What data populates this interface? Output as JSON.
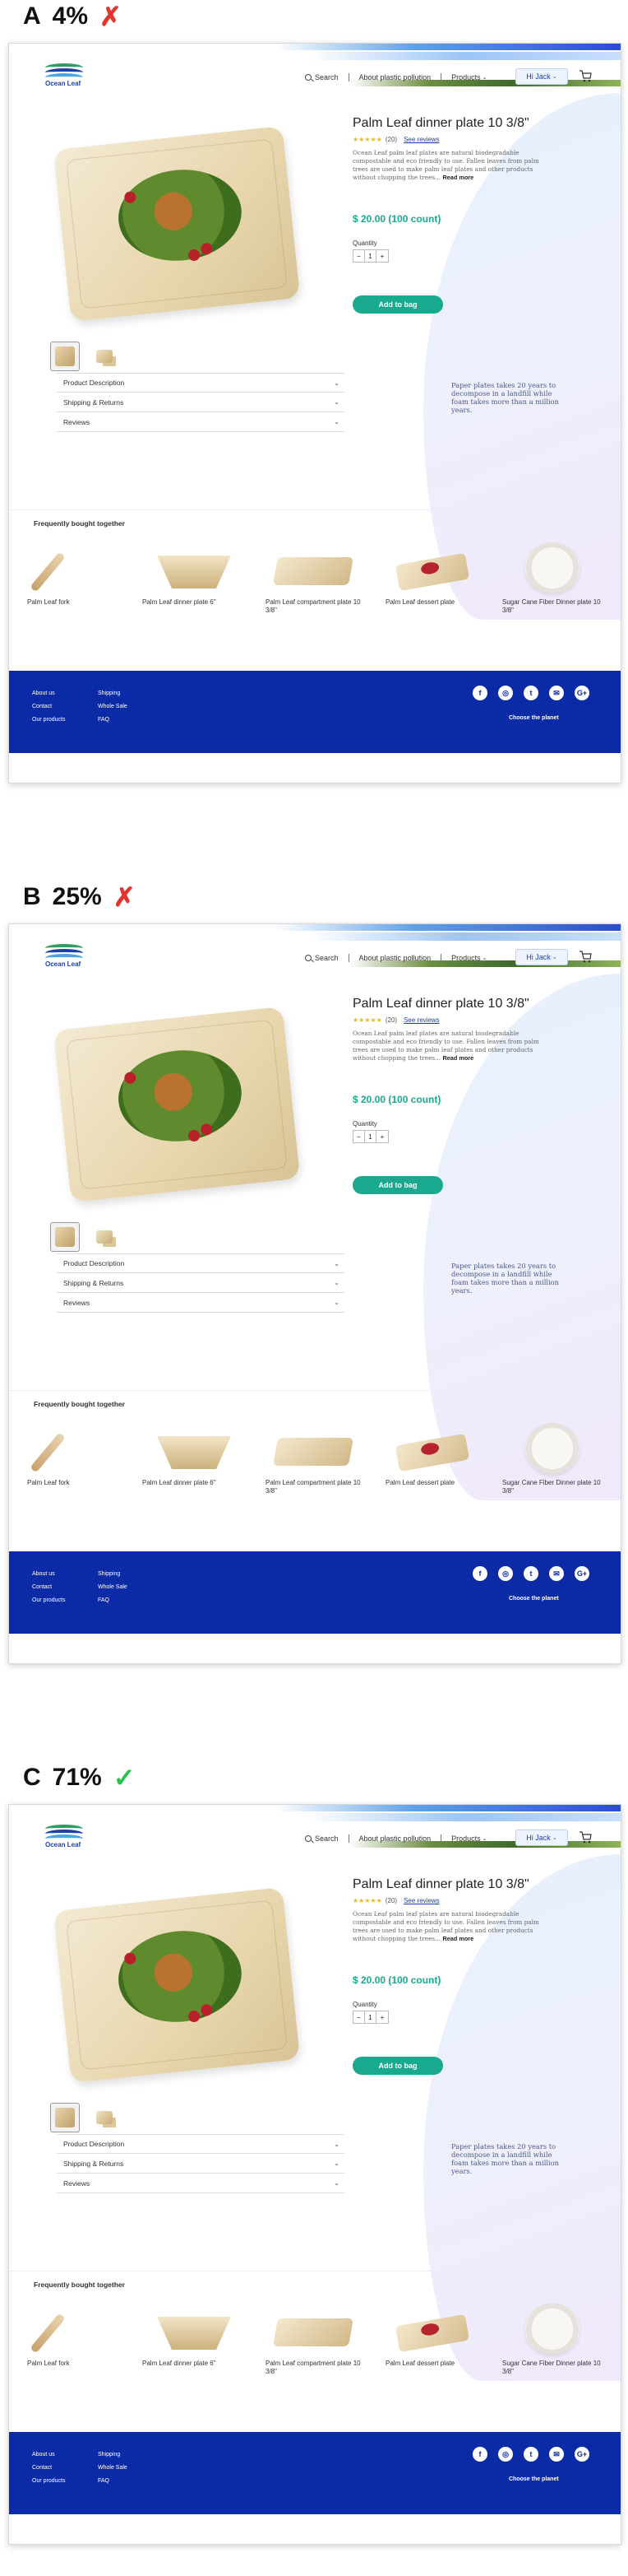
{
  "variants": [
    {
      "letter": "A",
      "score": "4%",
      "verdict": "✗",
      "good": false
    },
    {
      "letter": "B",
      "score": "25%",
      "verdict": "✗",
      "good": false
    },
    {
      "letter": "C",
      "score": "71%",
      "verdict": "✓",
      "good": true
    }
  ],
  "header": {
    "logo_text": "Ocean Leaf",
    "search": "Search",
    "about": "About plastic pollution",
    "products": "Products",
    "user": "Hi Jack"
  },
  "product": {
    "title": "Palm Leaf dinner plate  10 3/8\"",
    "stars": "★★★★★",
    "review_count": "(20)",
    "see_reviews": "See reviews",
    "description": "Ocean Leaf palm leaf plates are natural biodegradable compostable and eco friendly to use. Fallen leaves from palm trees are used to make palm leaf plates and other products without chopping the trees...",
    "read_more": "Read more",
    "price": "$ 20.00 (100 count)",
    "quantity_label": "Quantity",
    "qty_minus": "−",
    "qty_value": "1",
    "qty_plus": "+",
    "add_button": "Add to bag"
  },
  "accordion": [
    "Product Description",
    "Shipping & Returns",
    "Reviews"
  ],
  "blob_text": "Paper plates takes 20 years to decompose in a landfill while foam takes more than a million years.",
  "fbt": {
    "title": "Frequently bought together",
    "items": [
      {
        "name": "Palm Leaf fork",
        "icon": "fork"
      },
      {
        "name": "Palm Leaf dinner plate 6\"",
        "icon": "bowl"
      },
      {
        "name": "Palm Leaf compartment plate  10 3/8\"",
        "icon": "tray"
      },
      {
        "name": "Palm Leaf dessert plate",
        "icon": "dessert"
      },
      {
        "name": "Sugar Cane Fiber Dinner plate 10 3/8\"",
        "icon": "cane"
      }
    ]
  },
  "footer": {
    "col1": [
      "About us",
      "Contact",
      "Our products"
    ],
    "col2": [
      "Shipping",
      "Whole Sale",
      "FAQ"
    ],
    "social": [
      "facebook-icon",
      "instagram-icon",
      "twitter-icon",
      "email-icon",
      "google-plus-icon"
    ],
    "choose": "Choose the planet"
  },
  "colors": {
    "accent": "#19a98e",
    "brand": "#0b2aa6",
    "bad": "#e3342f",
    "good": "#27c24c"
  }
}
